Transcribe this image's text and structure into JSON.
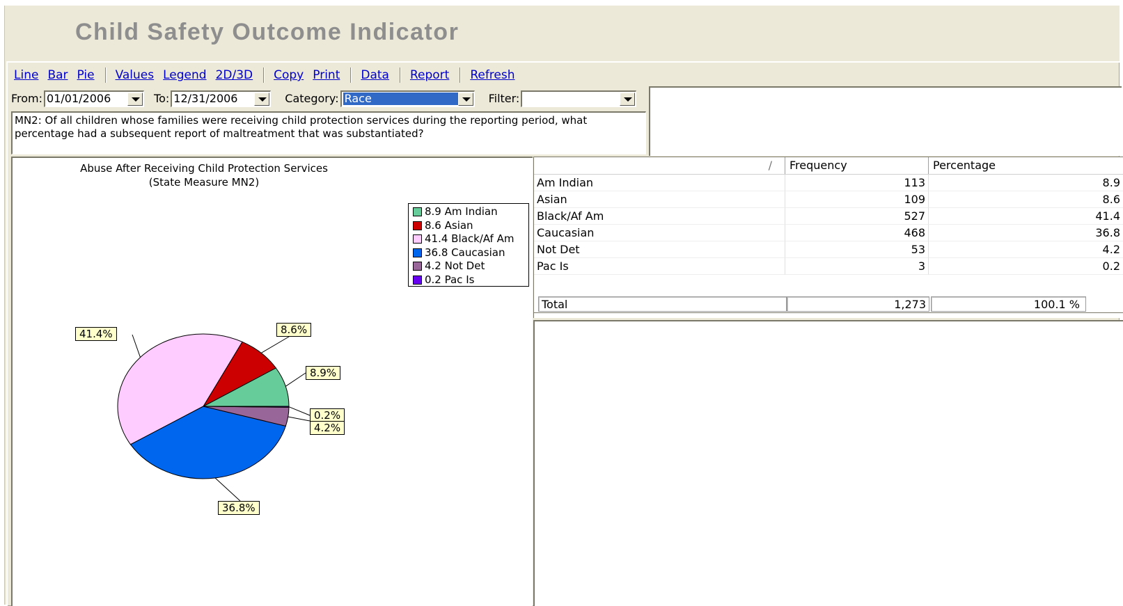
{
  "window": {
    "title": "Child Safety Outcome Indicator"
  },
  "toolbar": {
    "line": "Line",
    "bar": "Bar",
    "pie": "Pie",
    "values": "Values",
    "legend": "Legend",
    "dim": "2D/3D",
    "copy": "Copy",
    "print": "Print",
    "data": "Data",
    "report": "Report",
    "refresh": "Refresh"
  },
  "filters": {
    "from_label": "From:",
    "from_value": "01/01/2006",
    "to_label": "To:",
    "to_value": "12/31/2006",
    "category_label": "Category:",
    "category_value": "Race",
    "filter_label": "Filter:",
    "filter_value": ""
  },
  "question": "MN2: Of all children whose families were receiving child protection services during the reporting period, what percentage had a subsequent report of maltreatment that was substantiated?",
  "chart_data": {
    "type": "pie",
    "title": "Abuse After Receiving Child Protection Services",
    "subtitle": "(State Measure MN2)",
    "categories": [
      "Am Indian",
      "Asian",
      "Black/Af Am",
      "Caucasian",
      "Not Det",
      "Pac Is"
    ],
    "values": [
      8.9,
      8.6,
      41.4,
      36.8,
      4.2,
      0.2
    ],
    "data_labels": [
      "8.9%",
      "8.6%",
      "41.4%",
      "36.8%",
      "4.2%",
      "0.2%"
    ],
    "legend_entries": [
      "8.9 Am Indian",
      "8.6 Asian",
      "41.4 Black/Af Am",
      "36.8 Caucasian",
      "4.2 Not Det",
      "0.2 Pac Is"
    ],
    "colors": [
      "#66cc99",
      "#cc0000",
      "#ffccff",
      "#0066ee",
      "#996699",
      "#6600ee"
    ],
    "legend_position": "top-right"
  },
  "grid": {
    "sort_glyph": "/",
    "headers": {
      "category": "",
      "frequency": "Frequency",
      "percentage": "Percentage"
    },
    "rows": [
      {
        "category": "Am Indian",
        "frequency": "113",
        "percentage": "8.9"
      },
      {
        "category": "Asian",
        "frequency": "109",
        "percentage": "8.6"
      },
      {
        "category": "Black/Af Am",
        "frequency": "527",
        "percentage": "41.4"
      },
      {
        "category": "Caucasian",
        "frequency": "468",
        "percentage": "36.8"
      },
      {
        "category": "Not Det",
        "frequency": "53",
        "percentage": "4.2"
      },
      {
        "category": "Pac Is",
        "frequency": "3",
        "percentage": "0.2"
      }
    ],
    "total": {
      "label": "Total",
      "frequency": "1,273",
      "percentage": "100.1 %"
    }
  }
}
